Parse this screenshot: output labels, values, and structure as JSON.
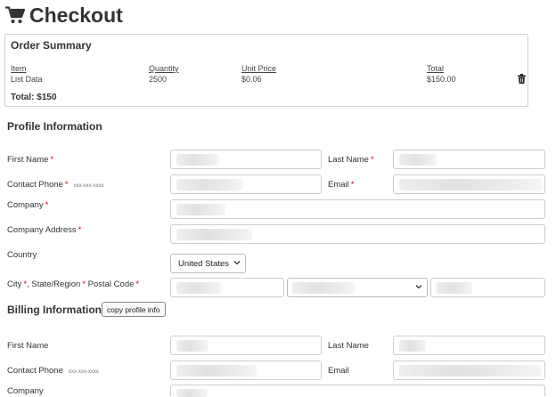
{
  "page": {
    "title": "Checkout",
    "icon": "shopping-cart-icon"
  },
  "order_summary": {
    "title": "Order Summary",
    "columns": {
      "item": "Item",
      "quantity": "Quantity",
      "unit_price": "Unit Price",
      "total": "Total"
    },
    "row": {
      "item": "List Data",
      "quantity": "2500",
      "unit_price": "$0.06",
      "total": "$150.00",
      "delete_icon": "trash-icon"
    },
    "total_label": "Total: $150"
  },
  "profile": {
    "title": "Profile Information",
    "first_name": "First Name",
    "last_name": "Last Name",
    "contact_phone": "Contact Phone",
    "contact_phone_hint": "xxx-xxx-xxxx",
    "email": "Email",
    "company": "Company",
    "company_address": "Company Address",
    "country": "Country",
    "country_value": "United States",
    "city": "City",
    "state": "State/Region",
    "postal": "Postal Code",
    "required_mark": "*"
  },
  "billing": {
    "title": "Billing Information",
    "copy_button": "copy profile info",
    "first_name": "First Name",
    "last_name": "Last Name",
    "contact_phone": "Contact Phone",
    "contact_phone_hint": "xxx-xxx-xxxx",
    "email": "Email",
    "company": "Company"
  },
  "colors": {
    "required": "#dd0000",
    "border": "#cccccc",
    "text": "#333333"
  }
}
